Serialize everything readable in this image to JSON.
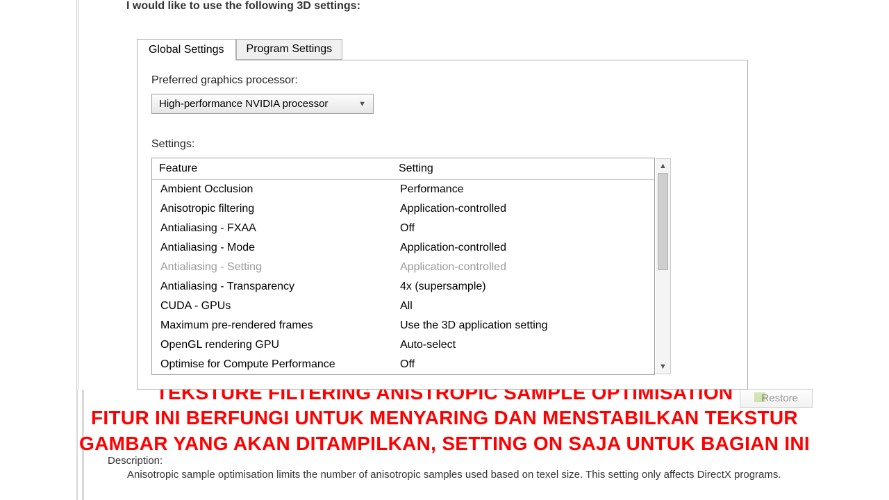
{
  "header": "I would like to use the following 3D settings:",
  "tabs": {
    "active": "Global Settings",
    "inactive": "Program Settings"
  },
  "gpu": {
    "label": "Preferred graphics processor:",
    "selected": "High-performance NVIDIA processor"
  },
  "settings_label": "Settings:",
  "table": {
    "head_feature": "Feature",
    "head_setting": "Setting",
    "rows": [
      {
        "f": "Ambient Occlusion",
        "s": "Performance"
      },
      {
        "f": "Anisotropic filtering",
        "s": "Application-controlled"
      },
      {
        "f": "Antialiasing - FXAA",
        "s": "Off"
      },
      {
        "f": "Antialiasing - Mode",
        "s": "Application-controlled"
      },
      {
        "f": "Antialiasing - Setting",
        "s": "Application-controlled",
        "disabled": true
      },
      {
        "f": "Antialiasing - Transparency",
        "s": "4x (supersample)"
      },
      {
        "f": "CUDA - GPUs",
        "s": "All"
      },
      {
        "f": "Maximum pre-rendered frames",
        "s": "Use the 3D application setting"
      },
      {
        "f": "OpenGL rendering GPU",
        "s": "Auto-select"
      },
      {
        "f": "Optimise for Compute Performance",
        "s": "Off",
        "cut": true
      }
    ]
  },
  "restore": "Restore",
  "overlay": {
    "l1": "TEKSTURE FILTERING ANISTROPIC SAMPLE OPTIMISATION",
    "l2": "FITUR INI BERFUNGI UNTUK MENYARING DAN MENSTABILKAN TEKSTUR",
    "l3": "GAMBAR YANG AKAN DITAMPILKAN, SETTING ON SAJA UNTUK BAGIAN INI"
  },
  "description": {
    "title": "Description:",
    "text": "Anisotropic sample optimisation limits the number of anisotropic samples used based on texel size. This setting only affects DirectX programs."
  }
}
